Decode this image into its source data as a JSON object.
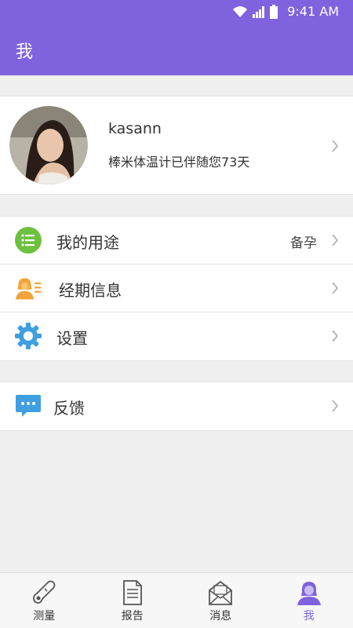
{
  "status": {
    "time": "9:41 AM"
  },
  "appbar": {
    "title": "我"
  },
  "profile": {
    "username": "kasann",
    "companion_text": "棒米体温计已伴随您73天"
  },
  "menu": {
    "purpose": {
      "label": "我的用途",
      "value": "备孕"
    },
    "period": {
      "label": "经期信息"
    },
    "settings": {
      "label": "设置"
    },
    "feedback": {
      "label": "反馈"
    }
  },
  "tabs": [
    {
      "label": "测量",
      "icon": "thermometer-icon"
    },
    {
      "label": "报告",
      "icon": "report-icon"
    },
    {
      "label": "消息",
      "icon": "mail-icon"
    },
    {
      "label": "我",
      "icon": "person-icon",
      "active": true
    }
  ],
  "colors": {
    "primary": "#7f63de",
    "green": "#6dc13f",
    "orange": "#f2a43a",
    "blue": "#3f9fe0"
  }
}
